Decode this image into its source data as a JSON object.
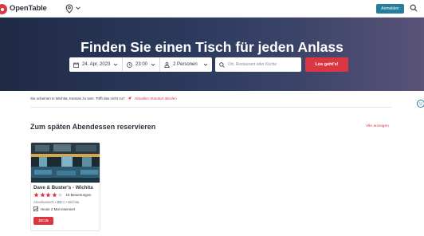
{
  "header": {
    "brand": "OpenTable",
    "login_label": "Anmelden"
  },
  "hero": {
    "title": "Finden Sie einen Tisch für jeden Anlass",
    "date": "24. Apr. 2023",
    "time": "23:00",
    "party": "2 Personen",
    "search_placeholder": "Ort, Restaurant oder Küche",
    "go_label": "Los geht's!"
  },
  "location_notice": {
    "text": "Sie scheinen in Wichita, Kansas zu sein. Trifft das nicht zu?",
    "link": "Aktuellen Standort abrufen"
  },
  "section": {
    "title": "Zum späten Abendessen reservieren",
    "see_all": "Alle anzeigen"
  },
  "restaurant": {
    "name": "Dave & Buster's - Wichita",
    "rating_stars": 4,
    "max_stars": 5,
    "reviews": "16 Bewertungen",
    "cuisine": "Amerikanisch",
    "price_active": "$$",
    "price_inactive": "$$",
    "area": "Wichita",
    "booked_today": "Heute 2 Mal reserviert",
    "time_slot": "23:15"
  },
  "colors": {
    "brand_red": "#da3743",
    "login_blue": "#247f9e",
    "hero_dark": "#1f2a45",
    "text": "#2d333f"
  },
  "icons": [
    "logo-icon",
    "location-pin-icon",
    "chevron-down-icon",
    "search-icon",
    "calendar-icon",
    "clock-icon",
    "person-icon",
    "location-arrow-icon",
    "star-icon",
    "trending-icon",
    "emoji-icon"
  ]
}
